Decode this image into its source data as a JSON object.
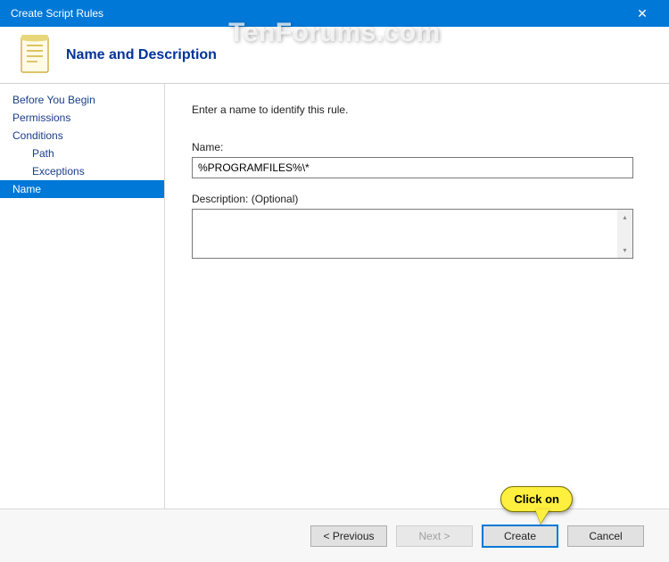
{
  "window": {
    "title": "Create Script Rules"
  },
  "header": {
    "heading": "Name and Description"
  },
  "sidebar": {
    "items": [
      {
        "label": "Before You Begin"
      },
      {
        "label": "Permissions"
      },
      {
        "label": "Conditions"
      },
      {
        "label": "Path"
      },
      {
        "label": "Exceptions"
      },
      {
        "label": "Name"
      }
    ]
  },
  "main": {
    "instruction": "Enter a name to identify this rule.",
    "name_label": "Name:",
    "name_value": "%PROGRAMFILES%\\*",
    "desc_label": "Description: (Optional)",
    "desc_value": ""
  },
  "footer": {
    "prev": "< Previous",
    "next": "Next >",
    "create": "Create",
    "cancel": "Cancel"
  },
  "watermark": "TenForums.com",
  "callout": {
    "text": "Click on"
  }
}
